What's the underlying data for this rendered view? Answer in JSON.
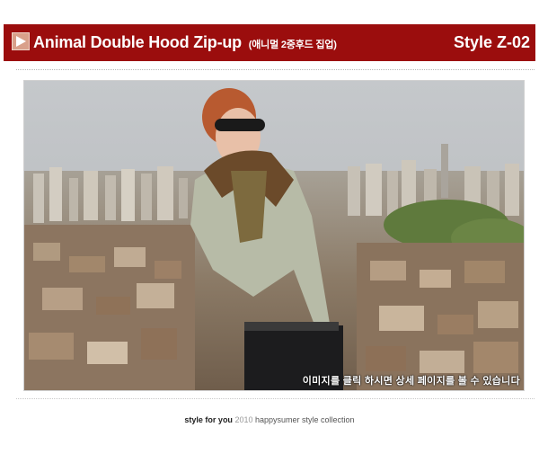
{
  "header": {
    "title": "Animal Double Hood Zip-up",
    "title_korean": "(애니멀 2중후드 집업)",
    "style_code": "Style Z-02",
    "bar_color": "#9b0d0d",
    "icon": "play-icon"
  },
  "photo": {
    "caption": "이미지를 클릭 하시면 상세 페이지를 볼 수 있습니다"
  },
  "footer": {
    "part1": "style for you",
    "part2": "2010",
    "part3": "happysumer style collection"
  }
}
